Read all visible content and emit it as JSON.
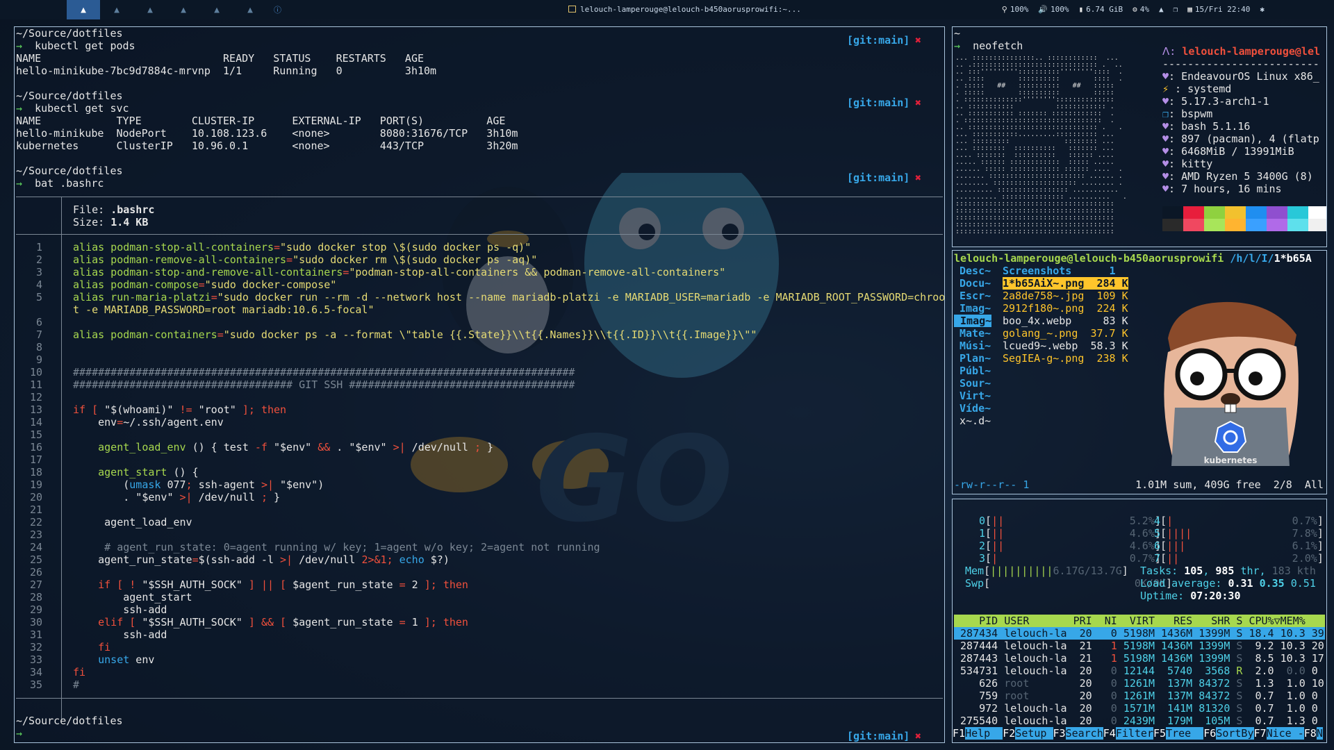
{
  "topbar": {
    "workspaces": [
      "▲",
      "▲",
      "▲",
      "▲",
      "▲",
      "▲"
    ],
    "info_icon": "ⓘ",
    "window_title": "lelouch-lamperouge@lelouch-b450aorusprowifi:~...",
    "status": {
      "brightness": "100%",
      "volume": "100%",
      "memory": "6.74 GiB",
      "cpu": "4%",
      "date": "15/Fri 22:40"
    }
  },
  "terminal": {
    "blocks": [
      {
        "path": "~/Source/dotfiles",
        "command": "kubectl get pods"
      },
      {
        "path": "~/Source/dotfiles",
        "command": "kubectl get svc"
      },
      {
        "path": "~/Source/dotfiles",
        "command": "bat .bashrc"
      }
    ],
    "git_label": "[git:main]",
    "git_x": "✖",
    "pods_header": "NAME                             READY   STATUS    RESTARTS   AGE",
    "pods_row": "hello-minikube-7bc9d7884c-mrvnp  1/1     Running   0          3h10m",
    "svc_header": "NAME            TYPE        CLUSTER-IP      EXTERNAL-IP   PORT(S)          AGE",
    "svc_rows": [
      "hello-minikube  NodePort    10.108.123.6    <none>        8080:31676/TCP   3h10m",
      "kubernetes      ClusterIP   10.96.0.1       <none>        443/TCP          3h20m"
    ],
    "bat": {
      "file_label": "File: ",
      "file_name": ".bashrc",
      "size_label": "Size: ",
      "size_value": "1.4 KB"
    },
    "final_path": "~/Source/dotfiles",
    "prompt": "→"
  },
  "neofetch": {
    "prompt_path": "~",
    "command": "neofetch",
    "user": "lelouch-lamperouge",
    "at_host": "@lel",
    "separator": "-------------------------",
    "info": [
      ": EndeavourOS Linux x86_",
      " : systemd",
      ": 5.17.3-arch1-1",
      ": bspwm",
      ": bash 5.1.16",
      ": 897 (pacman), 4 (flatp",
      ": 6468MiB / 13991MiB",
      ": kitty",
      ": AMD Ryzen 5 3400G (8)",
      ": 7 hours, 16 mins"
    ],
    "palette_top": [
      "#0b1726",
      "#e81e3c",
      "#8fd13f",
      "#f2c12e",
      "#1f8ef0",
      "#8f4fcf",
      "#28c8d8",
      "#ffffff"
    ],
    "palette_bottom": [
      "#2a2a2a",
      "#f04860",
      "#a8e55a",
      "#ffb430",
      "#3aa0ff",
      "#b06ae8",
      "#5ee0ec",
      "#f0f0f0"
    ]
  },
  "ranger": {
    "header_user": "lelouch-lamperouge@lelouch-b450aorusprowifi",
    "header_path": " /h/l/I/",
    "header_file": "1*b65A",
    "parent_dirs": [
      "Desc~",
      "Docu~",
      "Escr~",
      "Imag~",
      "Imag~",
      "Mate~",
      "Músi~",
      "Plan~",
      "Públ~",
      "Sour~",
      "Virt~",
      "Víde~",
      "x~.d~"
    ],
    "current_dir": "Screenshots",
    "current_count": "1",
    "files": [
      {
        "name": "1*b65AiX~.png",
        "size": "284 K"
      },
      {
        "name": "2a8de758~.jpg",
        "size": "109 K"
      },
      {
        "name": "2912f180~.png",
        "size": "224 K"
      },
      {
        "name": "boo_4x.webp",
        "size": "83 K"
      },
      {
        "name": "golang_~.png",
        "size": "37.7 K"
      },
      {
        "name": "lcued9~.webp",
        "size": "58.3 K"
      },
      {
        "name": "SegIEA-g~.png",
        "size": "238 K"
      }
    ],
    "status_perm": "-rw-r--r-- 1",
    "status_right": "1.01M sum, 409G free  2/8  All",
    "preview_label": "kubernetes"
  },
  "htop": {
    "cpus": [
      {
        "id": "0",
        "bar": "||",
        "pct": "5.2%"
      },
      {
        "id": "1",
        "bar": "||",
        "pct": "4.6%"
      },
      {
        "id": "2",
        "bar": "||",
        "pct": "4.6%"
      },
      {
        "id": "3",
        "bar": "|",
        "pct": "0.7%"
      },
      {
        "id": "4",
        "bar": "|",
        "pct": "0.7%"
      },
      {
        "id": "5",
        "bar": "||||",
        "pct": "7.8%"
      },
      {
        "id": "6",
        "bar": "|||",
        "pct": "6.1%"
      },
      {
        "id": "7",
        "bar": "||",
        "pct": "2.0%"
      }
    ],
    "mem_label": "Mem",
    "mem_bar": "||||||||||",
    "mem_value": "6.17G/13.7G",
    "swp_label": "Swp",
    "swp_value": "0K/0K",
    "tasks_label": "Tasks: ",
    "tasks": "105",
    "thr": "985",
    "thr_label": " thr, ",
    "kthr": "183 kth",
    "load_label": "Load average: ",
    "load": [
      "0.31",
      "0.35",
      "0.51"
    ],
    "uptime_label": "Uptime: ",
    "uptime": "07:20:30",
    "columns": "    PID USER       PRI  NI  VIRT   RES   SHR S CPU%▽MEM%",
    "processes": [
      {
        "pid": "287434",
        "user": "lelouch-la",
        "pri": "20",
        "ni": "0",
        "virt": "5198M",
        "res": "1436M",
        "shr": "1399M",
        "s": "S",
        "cpu": "18.4",
        "mem": "10.3",
        "t": "39"
      },
      {
        "pid": "287444",
        "user": "lelouch-la",
        "pri": "21",
        "ni": "1",
        "virt": "5198M",
        "res": "1436M",
        "shr": "1399M",
        "s": "S",
        "cpu": "9.2",
        "mem": "10.3",
        "t": "20"
      },
      {
        "pid": "287443",
        "user": "lelouch-la",
        "pri": "21",
        "ni": "1",
        "virt": "5198M",
        "res": "1436M",
        "shr": "1399M",
        "s": "S",
        "cpu": "8.5",
        "mem": "10.3",
        "t": "17"
      },
      {
        "pid": "534731",
        "user": "lelouch-la",
        "pri": "20",
        "ni": "0",
        "virt": "12144",
        "res": "5740",
        "shr": "3568",
        "s": "R",
        "cpu": "2.0",
        "mem": "0.0",
        "t": "0"
      },
      {
        "pid": "626",
        "user": "root",
        "pri": "20",
        "ni": "0",
        "virt": "1261M",
        "res": "137M",
        "shr": "84372",
        "s": "S",
        "cpu": "1.3",
        "mem": "1.0",
        "t": "10"
      },
      {
        "pid": "759",
        "user": "root",
        "pri": "20",
        "ni": "0",
        "virt": "1261M",
        "res": "137M",
        "shr": "84372",
        "s": "S",
        "cpu": "0.7",
        "mem": "1.0",
        "t": "0"
      },
      {
        "pid": "972",
        "user": "lelouch-la",
        "pri": "20",
        "ni": "0",
        "virt": "1571M",
        "res": "141M",
        "shr": "81320",
        "s": "S",
        "cpu": "0.7",
        "mem": "1.0",
        "t": "0"
      },
      {
        "pid": "275540",
        "user": "lelouch-la",
        "pri": "20",
        "ni": "0",
        "virt": "2439M",
        "res": "179M",
        "shr": "105M",
        "s": "S",
        "cpu": "0.7",
        "mem": "1.3",
        "t": "0"
      }
    ],
    "fkeys": [
      {
        "k": "F1",
        "l": "Help  "
      },
      {
        "k": "F2",
        "l": "Setup "
      },
      {
        "k": "F3",
        "l": "Search"
      },
      {
        "k": "F4",
        "l": "Filter"
      },
      {
        "k": "F5",
        "l": "Tree  "
      },
      {
        "k": "F6",
        "l": "SortBy"
      },
      {
        "k": "F7",
        "l": "Nice -"
      },
      {
        "k": "F8",
        "l": "N"
      }
    ]
  }
}
